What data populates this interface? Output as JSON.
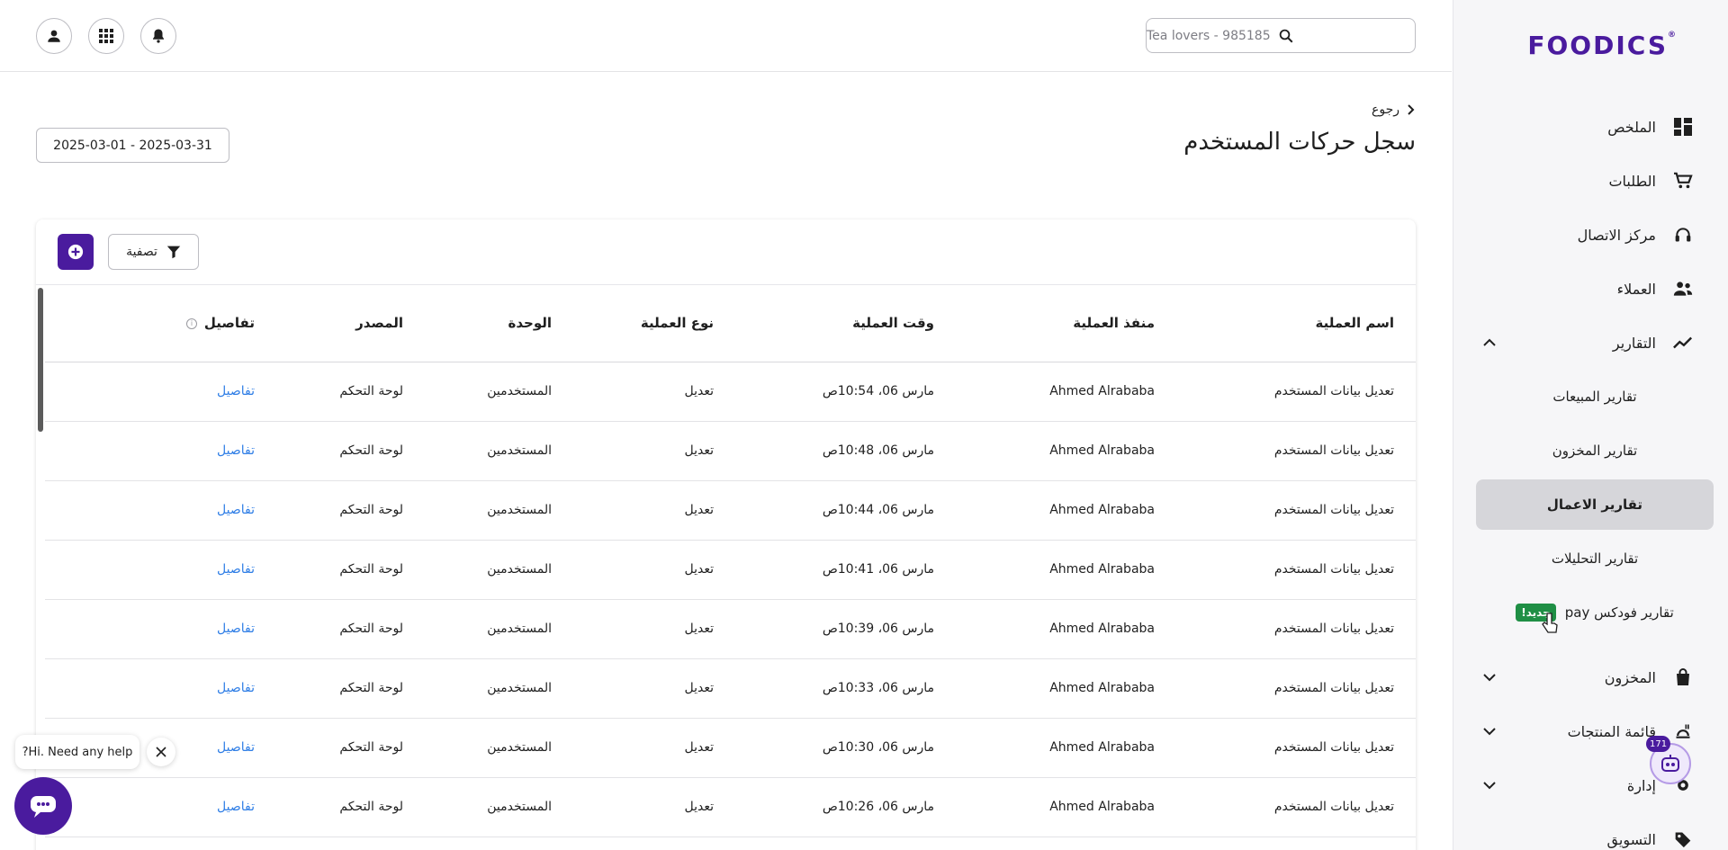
{
  "app": {
    "logo": "FOODICS",
    "logo_mark": "®"
  },
  "search": {
    "placeholder": "Tea lovers - 985185"
  },
  "header": {
    "back_label": "رجوع",
    "title": "سجل حركات المستخدم",
    "date_range": "2025-03-01 - 2025-03-31"
  },
  "toolbar": {
    "filter_label": "تصفية"
  },
  "sidebar": {
    "items": [
      {
        "label": "الملخص",
        "icon": "dashboard-icon"
      },
      {
        "label": "الطلبات",
        "icon": "cart-icon"
      },
      {
        "label": "مركز الاتصال",
        "icon": "headset-icon"
      },
      {
        "label": "العملاء",
        "icon": "people-icon"
      },
      {
        "label": "التقارير",
        "icon": "trend-icon",
        "expanded": true
      },
      {
        "label": "المخزون",
        "icon": "bag-icon"
      },
      {
        "label": "قائمة المنتجات",
        "icon": "menu-icon"
      },
      {
        "label": "إدارة",
        "icon": "gear-icon"
      },
      {
        "label": "التسويق",
        "icon": "tag-icon"
      }
    ],
    "report_subitems": [
      {
        "label": "تقارير المبيعات"
      },
      {
        "label": "تقارير المخزون"
      },
      {
        "label": "تقارير الاعمال",
        "active": true
      },
      {
        "label": "تقارير التحليلات"
      },
      {
        "label": "تقارير فودكس pay",
        "badge": "جديد!"
      }
    ]
  },
  "table": {
    "columns": [
      "اسم العملية",
      "منفذ العملية",
      "وقت العملية",
      "نوع العملية",
      "الوحدة",
      "المصدر",
      "تفاصيل"
    ],
    "rows": [
      {
        "name": "تعديل بيانات المستخدم",
        "actor": "Ahmed Alrababa",
        "time": "مارس 06، 10:54ص",
        "type": "تعديل",
        "unit": "المستخدمين",
        "source": "لوحة التحكم",
        "details": "تفاصيل"
      },
      {
        "name": "تعديل بيانات المستخدم",
        "actor": "Ahmed Alrababa",
        "time": "مارس 06، 10:48ص",
        "type": "تعديل",
        "unit": "المستخدمين",
        "source": "لوحة التحكم",
        "details": "تفاصيل"
      },
      {
        "name": "تعديل بيانات المستخدم",
        "actor": "Ahmed Alrababa",
        "time": "مارس 06، 10:44ص",
        "type": "تعديل",
        "unit": "المستخدمين",
        "source": "لوحة التحكم",
        "details": "تفاصيل"
      },
      {
        "name": "تعديل بيانات المستخدم",
        "actor": "Ahmed Alrababa",
        "time": "مارس 06، 10:41ص",
        "type": "تعديل",
        "unit": "المستخدمين",
        "source": "لوحة التحكم",
        "details": "تفاصيل"
      },
      {
        "name": "تعديل بيانات المستخدم",
        "actor": "Ahmed Alrababa",
        "time": "مارس 06، 10:39ص",
        "type": "تعديل",
        "unit": "المستخدمين",
        "source": "لوحة التحكم",
        "details": "تفاصيل"
      },
      {
        "name": "تعديل بيانات المستخدم",
        "actor": "Ahmed Alrababa",
        "time": "مارس 06، 10:33ص",
        "type": "تعديل",
        "unit": "المستخدمين",
        "source": "لوحة التحكم",
        "details": "تفاصيل"
      },
      {
        "name": "تعديل بيانات المستخدم",
        "actor": "Ahmed Alrababa",
        "time": "مارس 06، 10:30ص",
        "type": "تعديل",
        "unit": "المستخدمين",
        "source": "لوحة التحكم",
        "details": "تفاصيل"
      },
      {
        "name": "تعديل بيانات المستخدم",
        "actor": "Ahmed Alrababa",
        "time": "مارس 06، 10:26ص",
        "type": "تعديل",
        "unit": "المستخدمين",
        "source": "لوحة التحكم",
        "details": "تفاصيل"
      }
    ]
  },
  "help": {
    "bubble_text": "Hi. Need any help?",
    "bot_badge": "171"
  },
  "colors": {
    "brand": "#4a1b9e",
    "link": "#2f7ee6",
    "new_badge": "#1f8f45",
    "active_bg": "#d6d6da"
  }
}
